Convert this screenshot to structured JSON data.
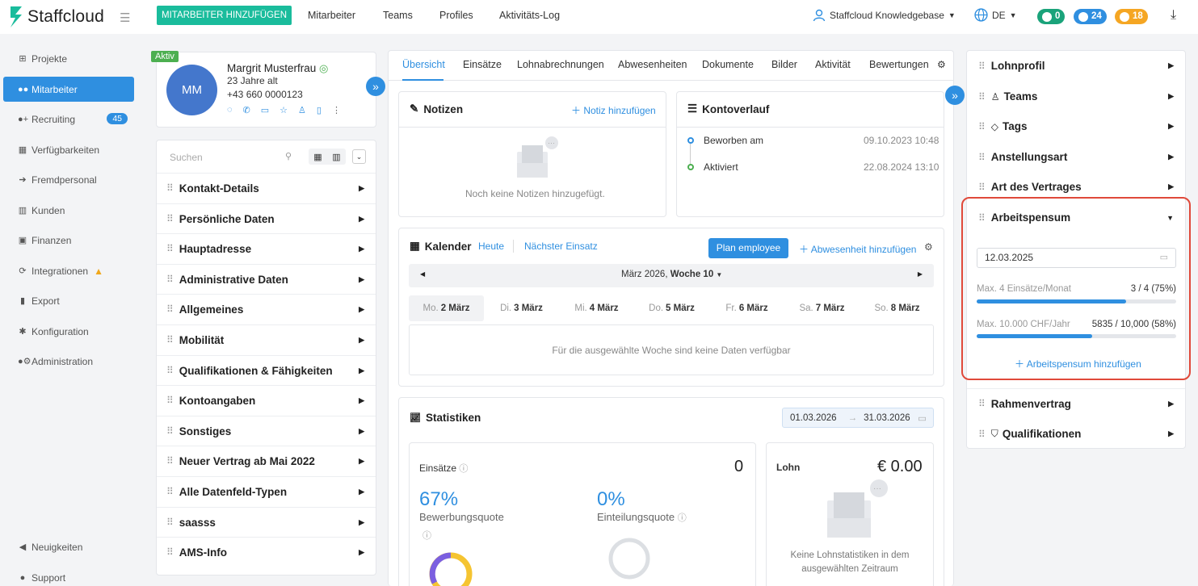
{
  "header": {
    "logo": "Staffcloud",
    "add_button": "MITARBEITER HINZUFÜGEN",
    "nav": [
      "Mitarbeiter",
      "Teams",
      "Profiles",
      "Aktivitäts-Log"
    ],
    "knowledgebase": "Staffcloud Knowledgebase",
    "language": "DE",
    "pills": [
      {
        "value": "0",
        "color": "#1aa37a"
      },
      {
        "value": "24",
        "color": "#2f8fe0"
      },
      {
        "value": "18",
        "color": "#f5a623"
      }
    ]
  },
  "sidebar": {
    "items": [
      {
        "label": "Projekte",
        "icon": "sitemap-icon"
      },
      {
        "label": "Mitarbeiter",
        "icon": "users-icon"
      },
      {
        "label": "Recruiting",
        "icon": "user-plus-icon",
        "badge": "45"
      },
      {
        "label": "Verfügbarkeiten",
        "icon": "calendar-icon"
      },
      {
        "label": "Fremdpersonal",
        "icon": "sign-in-icon"
      },
      {
        "label": "Kunden",
        "icon": "building-icon"
      },
      {
        "label": "Finanzen",
        "icon": "money-icon"
      },
      {
        "label": "Integrationen",
        "icon": "sync-icon"
      },
      {
        "label": "Export",
        "icon": "file-icon"
      },
      {
        "label": "Konfiguration",
        "icon": "gear-icon"
      },
      {
        "label": "Administration",
        "icon": "user-cog-icon"
      }
    ],
    "bottom": [
      {
        "label": "Neuigkeiten",
        "icon": "megaphone-icon"
      },
      {
        "label": "Support",
        "icon": "support-icon"
      }
    ]
  },
  "profile": {
    "status": "Aktiv",
    "initials": "MM",
    "name": "Margrit Musterfrau",
    "age": "23 Jahre alt",
    "phone": "+43 660 0000123"
  },
  "left_panel": {
    "search_placeholder": "Suchen",
    "sections": [
      "Kontakt-Details",
      "Persönliche Daten",
      "Hauptadresse",
      "Administrative Daten",
      "Allgemeines",
      "Mobilität",
      "Qualifikationen & Fähigkeiten",
      "Kontoangaben",
      "Sonstiges",
      "Neuer Vertrag ab Mai 2022",
      "Alle Datenfeld-Typen",
      "saasss",
      "AMS-Info"
    ]
  },
  "tabs": [
    "Übersicht",
    "Einsätze",
    "Lohnabrechnungen",
    "Abwesenheiten",
    "Dokumente",
    "Bilder",
    "Aktivität",
    "Bewertungen"
  ],
  "notizen": {
    "title": "Notizen",
    "add": "Notiz hinzufügen",
    "empty": "Noch keine Notizen hinzugefügt."
  },
  "kontoverlauf": {
    "title": "Kontoverlauf",
    "entries": [
      {
        "label": "Beworben am",
        "date": "09.10.2023 10:48",
        "color": "#2f8fe0"
      },
      {
        "label": "Aktiviert",
        "date": "22.08.2024 13:10",
        "color": "#4caf50"
      }
    ]
  },
  "kalender": {
    "title": "Kalender",
    "today": "Heute",
    "next": "Nächster Einsatz",
    "plan_btn": "Plan employee",
    "add_absence": "Abwesenheit hinzufügen",
    "month": "März 2026,",
    "week": "Woche 10",
    "days": [
      {
        "dow": "Mo.",
        "date": "2 März"
      },
      {
        "dow": "Di.",
        "date": "3 März"
      },
      {
        "dow": "Mi.",
        "date": "4 März"
      },
      {
        "dow": "Do.",
        "date": "5 März"
      },
      {
        "dow": "Fr.",
        "date": "6 März"
      },
      {
        "dow": "Sa.",
        "date": "7 März"
      },
      {
        "dow": "So.",
        "date": "8 März"
      }
    ],
    "empty": "Für die ausgewählte Woche sind keine Daten verfügbar"
  },
  "statistiken": {
    "title": "Statistiken",
    "from": "01.03.2026",
    "to": "31.03.2026",
    "einsaetze_label": "Einsätze",
    "einsaetze_value": "0",
    "bewerbung_pct": "67%",
    "bewerbung_label": "Bewerbungsquote",
    "einteilung_pct": "0%",
    "einteilung_label": "Einteilungsquote",
    "lohn_label": "Lohn",
    "lohn_value": "€ 0.00",
    "lohn_empty": "Keine Lohnstatistiken in dem ausgewählten Zeitraum"
  },
  "right_panel": {
    "items_top": [
      "Lohnprofil",
      "Teams",
      "Tags",
      "Anstellungsart",
      "Art des Vertrages"
    ],
    "arbeitspensum": {
      "title": "Arbeitspensum",
      "date": "12.03.2025",
      "limit1_label": "Max. 4 Einsätze/Monat",
      "limit1_value": "3 / 4 (75%)",
      "limit1_fraction": 0.75,
      "limit2_label": "Max. 10.000 CHF/Jahr",
      "limit2_value": "5835 / 10,000 (58%)",
      "limit2_fraction": 0.58,
      "add": "Arbeitspensum hinzufügen"
    },
    "items_bottom": [
      "Rahmenvertrag",
      "Qualifikationen"
    ]
  }
}
